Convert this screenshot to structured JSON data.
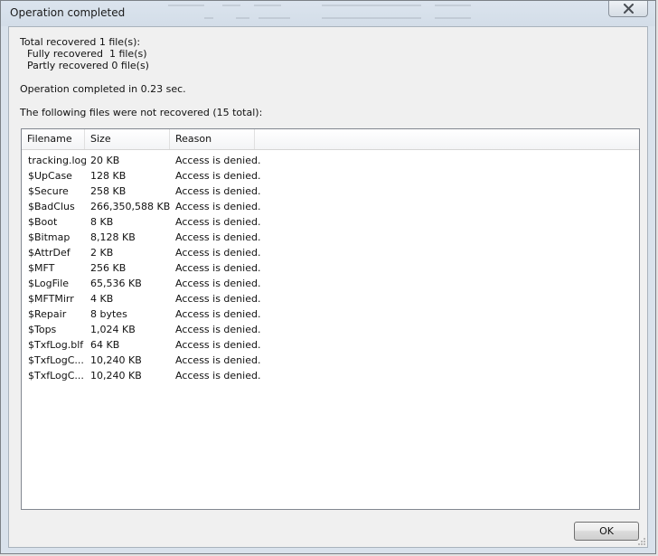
{
  "window": {
    "title": "Operation completed"
  },
  "summary": {
    "total": "Total recovered 1 file(s):",
    "fully": "Fully recovered  1 file(s)",
    "partly": "Partly recovered 0 file(s)",
    "time": "Operation completed in 0.23 sec.",
    "not_recovered": "The following files were not recovered (15 total):"
  },
  "table": {
    "columns": [
      "Filename",
      "Size",
      "Reason"
    ],
    "rows": [
      [
        "tracking.log",
        "20 KB",
        "Access is denied."
      ],
      [
        "$UpCase",
        "128 KB",
        "Access is denied."
      ],
      [
        "$Secure",
        "258 KB",
        "Access is denied."
      ],
      [
        "$BadClus",
        "266,350,588 KB",
        "Access is denied."
      ],
      [
        "$Boot",
        "8 KB",
        "Access is denied."
      ],
      [
        "$Bitmap",
        "8,128 KB",
        "Access is denied."
      ],
      [
        "$AttrDef",
        "2 KB",
        "Access is denied."
      ],
      [
        "$MFT",
        "256 KB",
        "Access is denied."
      ],
      [
        "$LogFile",
        "65,536 KB",
        "Access is denied."
      ],
      [
        "$MFTMirr",
        "4 KB",
        "Access is denied."
      ],
      [
        "$Repair",
        "8 bytes",
        "Access is denied."
      ],
      [
        "$Tops",
        "1,024 KB",
        "Access is denied."
      ],
      [
        "$TxfLog.blf",
        "64 KB",
        "Access is denied."
      ],
      [
        "$TxfLogC...",
        "10,240 KB",
        "Access is denied."
      ],
      [
        "$TxfLogC...",
        "10,240 KB",
        "Access is denied."
      ]
    ]
  },
  "buttons": {
    "ok": "OK"
  },
  "icons": {
    "close": "close-icon",
    "resize": "resize-grip-icon"
  }
}
